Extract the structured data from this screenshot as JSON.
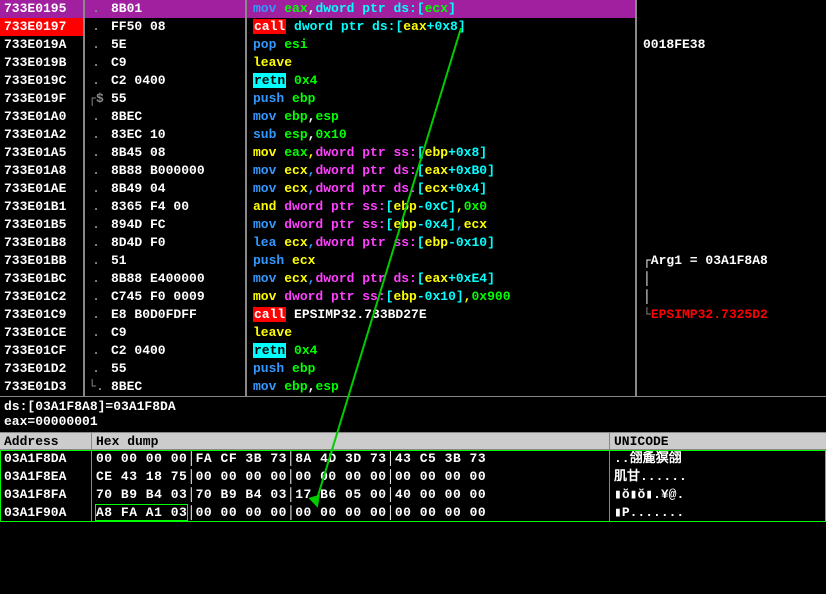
{
  "disasm": {
    "rows": [
      {
        "addr": "733E0195",
        "pfx": ".",
        "hex": "8B01",
        "asm": [
          [
            "c-blue",
            "mov "
          ],
          [
            "c-green",
            "eax"
          ],
          [
            "c-white",
            ","
          ],
          [
            "c-cyan",
            "dword ptr ds:["
          ],
          [
            "c-green",
            "ecx"
          ],
          [
            "c-cyan",
            "]"
          ]
        ],
        "cmt": "",
        "hl": "purple"
      },
      {
        "addr": "733E0197",
        "pfx": ".",
        "hex": "FF50 08",
        "asm": [
          [
            "bg-red",
            "call"
          ],
          [
            "c-white",
            " "
          ],
          [
            "c-cyan",
            "dword ptr ds:["
          ],
          [
            "c-yellow",
            "eax"
          ],
          [
            "c-cyan",
            "+0x8]"
          ]
        ],
        "cmt": "",
        "hl": "red"
      },
      {
        "addr": "733E019A",
        "pfx": ".",
        "hex": "5E",
        "asm": [
          [
            "c-blue",
            "pop "
          ],
          [
            "c-green",
            "esi"
          ]
        ],
        "cmt": "0018FE38"
      },
      {
        "addr": "733E019B",
        "pfx": ".",
        "hex": "C9",
        "asm": [
          [
            "c-yellow",
            "leave"
          ]
        ],
        "cmt": ""
      },
      {
        "addr": "733E019C",
        "pfx": ".",
        "hex": "C2 0400",
        "asm": [
          [
            "bg-cyan",
            "retn"
          ],
          [
            "c-green",
            " 0x4"
          ]
        ],
        "cmt": ""
      },
      {
        "addr": "733E019F",
        "pfx": "┌$",
        "hex": "55",
        "asm": [
          [
            "c-blue",
            "push "
          ],
          [
            "c-green",
            "ebp"
          ]
        ],
        "cmt": ""
      },
      {
        "addr": "733E01A0",
        "pfx": ".",
        "hex": "8BEC",
        "asm": [
          [
            "c-blue",
            "mov "
          ],
          [
            "c-green",
            "ebp"
          ],
          [
            "c-white",
            ","
          ],
          [
            "c-green",
            "esp"
          ]
        ],
        "cmt": ""
      },
      {
        "addr": "733E01A2",
        "pfx": ".",
        "hex": "83EC 10",
        "asm": [
          [
            "c-blue",
            "sub "
          ],
          [
            "c-green",
            "esp"
          ],
          [
            "c-white",
            ","
          ],
          [
            "c-green",
            "0x10"
          ]
        ],
        "cmt": ""
      },
      {
        "addr": "733E01A5",
        "pfx": ".",
        "hex": "8B45 08",
        "asm": [
          [
            "c-yellow",
            "mov "
          ],
          [
            "c-green",
            "eax"
          ],
          [
            "c-yellow",
            ","
          ],
          [
            "c-magenta",
            "dword ptr ss:"
          ],
          [
            "c-cyan",
            "["
          ],
          [
            "c-yellow",
            "ebp"
          ],
          [
            "c-cyan",
            "+0x8]"
          ]
        ],
        "cmt": ""
      },
      {
        "addr": "733E01A8",
        "pfx": ".",
        "hex": "8B88 B000000",
        "asm": [
          [
            "c-blue",
            "mov "
          ],
          [
            "c-yellow",
            "ecx"
          ],
          [
            "c-blue",
            ","
          ],
          [
            "c-magenta",
            "dword ptr ds:"
          ],
          [
            "c-cyan",
            "["
          ],
          [
            "c-yellow",
            "eax"
          ],
          [
            "c-cyan",
            "+0xB0]"
          ]
        ],
        "cmt": ""
      },
      {
        "addr": "733E01AE",
        "pfx": ".",
        "hex": "8B49 04",
        "asm": [
          [
            "c-blue",
            "mov "
          ],
          [
            "c-yellow",
            "ecx"
          ],
          [
            "c-blue",
            ","
          ],
          [
            "c-magenta",
            "dword ptr ds:"
          ],
          [
            "c-cyan",
            "["
          ],
          [
            "c-yellow",
            "ecx"
          ],
          [
            "c-cyan",
            "+0x4]"
          ]
        ],
        "cmt": ""
      },
      {
        "addr": "733E01B1",
        "pfx": ".",
        "hex": "8365 F4 00",
        "asm": [
          [
            "c-yellow",
            "and "
          ],
          [
            "c-magenta",
            "dword ptr ss:"
          ],
          [
            "c-cyan",
            "["
          ],
          [
            "c-yellow",
            "ebp"
          ],
          [
            "c-cyan",
            "-0xC]"
          ],
          [
            "c-yellow",
            ","
          ],
          [
            "c-green",
            "0x0"
          ]
        ],
        "cmt": ""
      },
      {
        "addr": "733E01B5",
        "pfx": ".",
        "hex": "894D FC",
        "asm": [
          [
            "c-blue",
            "mov "
          ],
          [
            "c-magenta",
            "dword ptr ss:"
          ],
          [
            "c-cyan",
            "["
          ],
          [
            "c-yellow",
            "ebp"
          ],
          [
            "c-cyan",
            "-0x4]"
          ],
          [
            "c-blue",
            ","
          ],
          [
            "c-yellow",
            "ecx"
          ]
        ],
        "cmt": ""
      },
      {
        "addr": "733E01B8",
        "pfx": ".",
        "hex": "8D4D F0",
        "asm": [
          [
            "c-blue",
            "lea "
          ],
          [
            "c-yellow",
            "ecx"
          ],
          [
            "c-blue",
            ","
          ],
          [
            "c-magenta",
            "dword ptr ss:"
          ],
          [
            "c-cyan",
            "["
          ],
          [
            "c-yellow",
            "ebp"
          ],
          [
            "c-cyan",
            "-0x10]"
          ]
        ],
        "cmt": ""
      },
      {
        "addr": "733E01BB",
        "pfx": ".",
        "hex": "51",
        "asm": [
          [
            "c-blue",
            "push "
          ],
          [
            "c-yellow",
            "ecx"
          ]
        ],
        "cmt": "┌Arg1 = 03A1F8A8"
      },
      {
        "addr": "733E01BC",
        "pfx": ".",
        "hex": "8B88 E400000",
        "asm": [
          [
            "c-blue",
            "mov "
          ],
          [
            "c-yellow",
            "ecx"
          ],
          [
            "c-blue",
            ","
          ],
          [
            "c-magenta",
            "dword ptr ds:"
          ],
          [
            "c-cyan",
            "["
          ],
          [
            "c-yellow",
            "eax"
          ],
          [
            "c-cyan",
            "+0xE4]"
          ]
        ],
        "cmt": "│"
      },
      {
        "addr": "733E01C2",
        "pfx": ".",
        "hex": "C745 F0 0009",
        "asm": [
          [
            "c-yellow",
            "mov "
          ],
          [
            "c-magenta",
            "dword ptr ss:"
          ],
          [
            "c-cyan",
            "["
          ],
          [
            "c-yellow",
            "ebp"
          ],
          [
            "c-cyan",
            "-0x10]"
          ],
          [
            "c-yellow",
            ","
          ],
          [
            "c-green",
            "0x900"
          ]
        ],
        "cmt": "│"
      },
      {
        "addr": "733E01C9",
        "pfx": ".",
        "hex": "E8 B0D0FDFF",
        "asm": [
          [
            "bg-red",
            "call"
          ],
          [
            "c-white",
            " EPSIMP32.733BD27E"
          ]
        ],
        "cmt": "└",
        "cmt2": "EPSIMP32.7325D2",
        "cmtred": true
      },
      {
        "addr": "733E01CE",
        "pfx": ".",
        "hex": "C9",
        "asm": [
          [
            "c-yellow",
            "leave"
          ]
        ],
        "cmt": ""
      },
      {
        "addr": "733E01CF",
        "pfx": ".",
        "hex": "C2 0400",
        "asm": [
          [
            "bg-cyan",
            "retn"
          ],
          [
            "c-green",
            " 0x4"
          ]
        ],
        "cmt": ""
      },
      {
        "addr": "733E01D2",
        "pfx": ".",
        "hex": "55",
        "asm": [
          [
            "c-blue",
            "push "
          ],
          [
            "c-green",
            "ebp"
          ]
        ],
        "cmt": ""
      },
      {
        "addr": "733E01D3",
        "pfx": "└.",
        "hex": "8BEC",
        "asm": [
          [
            "c-blue",
            "mov "
          ],
          [
            "c-green",
            "ebp"
          ],
          [
            "c-white",
            ","
          ],
          [
            "c-green",
            "esp"
          ]
        ],
        "cmt": ""
      }
    ]
  },
  "status": {
    "line1": "ds:[03A1F8A8]=03A1F8DA",
    "line2": "eax=00000001"
  },
  "headers": {
    "addr": "Address",
    "hex": "Hex dump",
    "uni": "UNICODE"
  },
  "dump": [
    {
      "addr": "03A1F8DA",
      "hex": "00 00 00 00│FA CF 3B 73│8A 4D 3D 73│43 C5 3B 73",
      "uni": "..翖麁猽翖",
      "sel": false
    },
    {
      "addr": "03A1F8EA",
      "hex": "CE 43 18 75│00 00 00 00│00 00 00 00│00 00 00 00",
      "uni": "肌甘......",
      "sel": false
    },
    {
      "addr": "03A1F8FA",
      "hex": "70 B9 B4 03│70 B9 B4 03│17 B6 05 00│40 00 00 00",
      "uni": "▮ŏ▮ŏ▮.¥@.",
      "sel": false
    },
    {
      "addr": "03A1F90A",
      "hex": "A8 FA A1 03│00 00 00 00│00 00 00 00│00 00 00 00",
      "uni": "▮P.......",
      "sel": true
    }
  ]
}
